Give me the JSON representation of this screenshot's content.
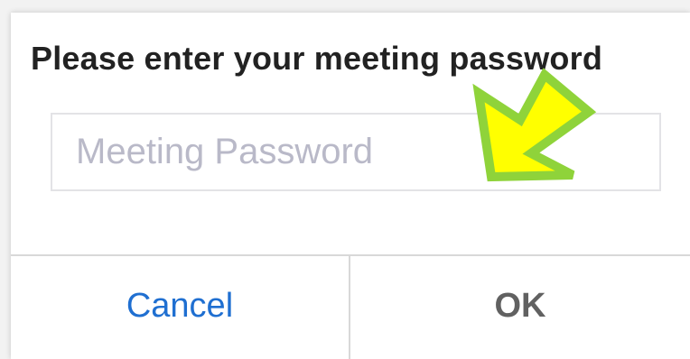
{
  "dialog": {
    "title": "Please enter your meeting password",
    "password_field": {
      "placeholder": "Meeting Password",
      "value": ""
    },
    "buttons": {
      "cancel_label": "Cancel",
      "ok_label": "OK"
    }
  },
  "annotation": {
    "arrow_icon": "pointer-arrow-icon",
    "fill_color": "#ffff00",
    "stroke_color": "#8fd33a"
  },
  "colors": {
    "cancel_text": "#1f6fd1",
    "ok_text": "#616161",
    "title_text": "#222222",
    "placeholder_text": "#b9b9c8"
  }
}
